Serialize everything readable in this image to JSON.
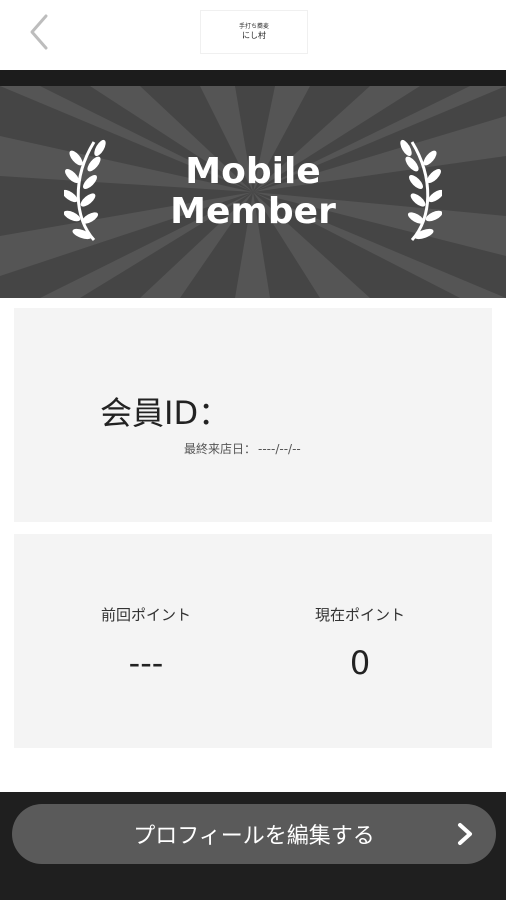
{
  "header": {
    "logo_line1": "手打ち蕎麦",
    "logo_line2": "にし村"
  },
  "banner": {
    "title_line1": "Mobile",
    "title_line2": "Member"
  },
  "member": {
    "id_label": "会員ID：",
    "last_visit_label": "最終来店日：",
    "last_visit_value": "----/--/--"
  },
  "points": {
    "previous_label": "前回ポイント",
    "previous_value": "---",
    "current_label": "現在ポイント",
    "current_value": "0"
  },
  "footer": {
    "edit_profile_label": "プロフィールを編集する"
  },
  "icons": {
    "back": "chevron-left-icon",
    "next": "chevron-right-icon",
    "laurel": "laurel-icon"
  },
  "colors": {
    "banner": "#454545",
    "button": "#5a5a5a",
    "card": "#f4f4f4",
    "footer": "#1f1f1f"
  }
}
